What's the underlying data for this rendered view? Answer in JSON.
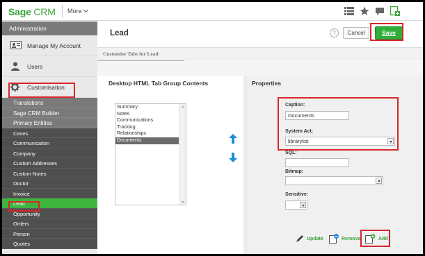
{
  "app": {
    "logo_brand": "Sage",
    "logo_product": "CRM",
    "more_label": "More"
  },
  "toolbar_icons": [
    "list-icon",
    "star-icon",
    "comment-icon",
    "add-document-icon"
  ],
  "sidebar": {
    "admin_label": "Administration",
    "top_items": [
      {
        "label": "Manage My Account",
        "icon": "id-card-icon"
      },
      {
        "label": "Users",
        "icon": "user-icon"
      },
      {
        "label": "Customisation",
        "icon": "gear-icon"
      }
    ],
    "sub_items": [
      "Translations",
      "Sage CRM Builder",
      "Primary Entities"
    ],
    "entities": [
      "Cases",
      "Communication",
      "Company",
      "Custom Addresses",
      "Custom Notes",
      "Doctor",
      "Invoice",
      "Lead",
      "Opportunity",
      "Orders",
      "Person",
      "Quotes"
    ],
    "active_entity": "Lead"
  },
  "main": {
    "title": "Lead",
    "help_label": "?",
    "cancel_label": "Cancel",
    "save_label": "Save",
    "subtitle": "Customise Tabs for Lead"
  },
  "tab_group": {
    "heading": "Desktop HTML Tab Group Contents",
    "items": [
      "Summary",
      "Notes",
      "Communications",
      "Tracking",
      "Relationships",
      "Documents"
    ],
    "selected": "Documents"
  },
  "properties": {
    "heading": "Properties",
    "caption_label": "Caption:",
    "caption_value": "Documents",
    "system_act_label": "System Act:",
    "system_act_value": "librarylist",
    "sql_label": "SQL:",
    "sql_value": "",
    "bitmap_label": "Bitmap:",
    "bitmap_value": "",
    "sensitive_label": "Sensitive:",
    "sensitive_value": ""
  },
  "actions": {
    "update_label": "Update",
    "remove_label": "Remove",
    "add_label": "Add"
  },
  "colors": {
    "brand_green": "#3aa53a",
    "save_green": "#2fae39",
    "arrow_blue": "#1e8fd6",
    "highlight_red": "#d9262a",
    "sidebar_dark": "#4f4f4f"
  }
}
